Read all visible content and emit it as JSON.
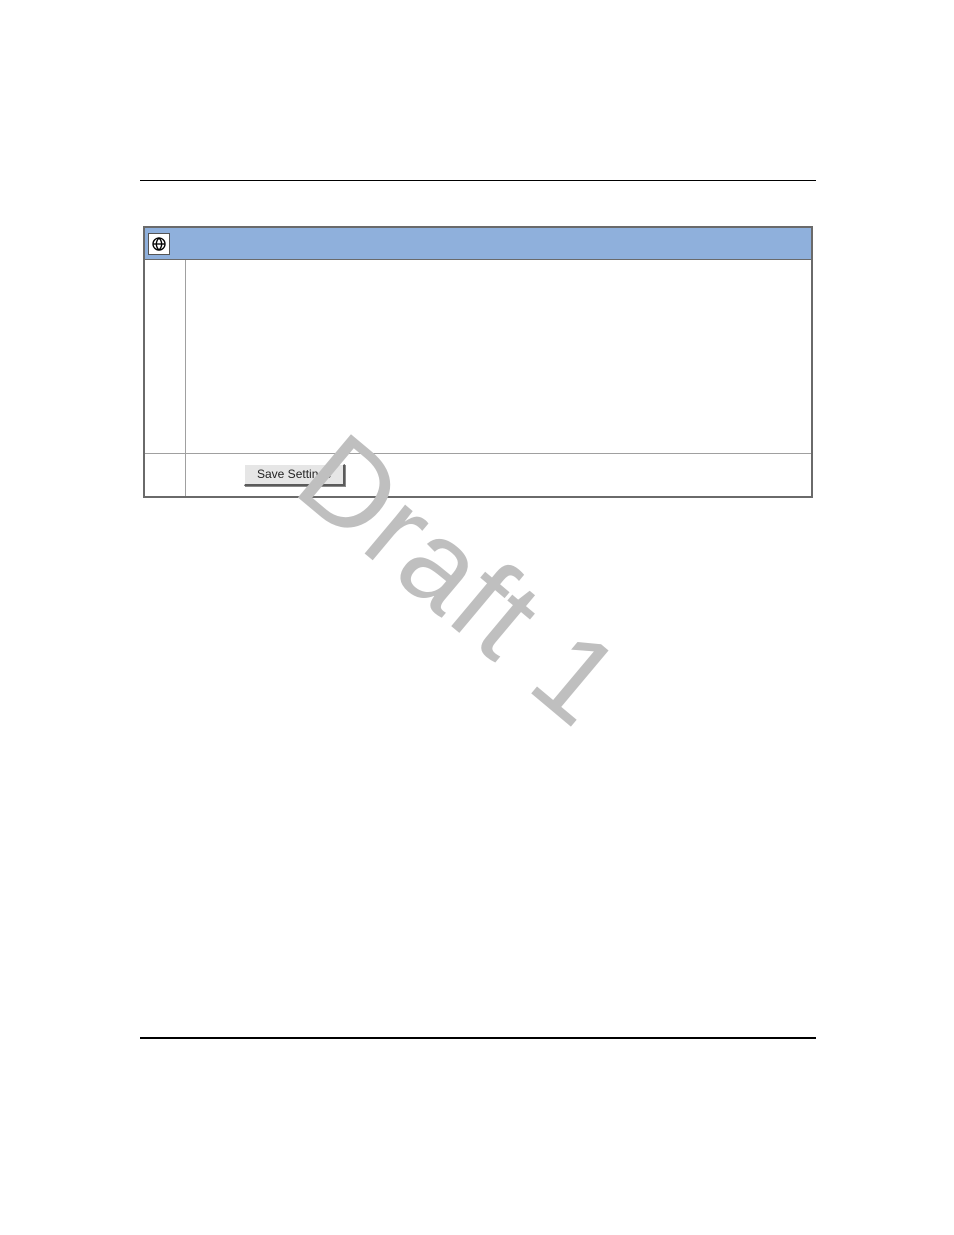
{
  "watermark": "Draft 1",
  "window": {
    "icon_name": "globe-icon",
    "button_label": "Save Settings"
  }
}
